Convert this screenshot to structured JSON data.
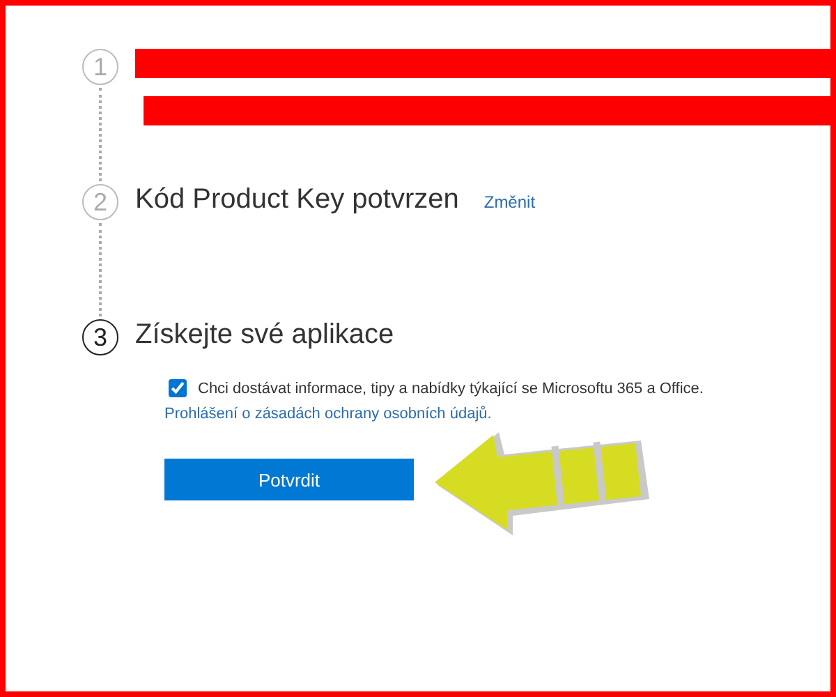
{
  "steps": [
    {
      "number": "1",
      "completed": true,
      "redacted": true
    },
    {
      "number": "2",
      "completed": true,
      "redacted": false,
      "title": "Kód Product Key potvrzen",
      "link": "Změnit"
    },
    {
      "number": "3",
      "completed": false,
      "redacted": false,
      "title": "Získejte své aplikace"
    }
  ],
  "consent": {
    "checked": true,
    "text": "Chci dostávat informace, tipy a nabídky týkající se Microsoftu 365 a Office.",
    "privacy_link": "Prohlášení o zásadách ochrany osobních údajů."
  },
  "button": "Potvrdit"
}
